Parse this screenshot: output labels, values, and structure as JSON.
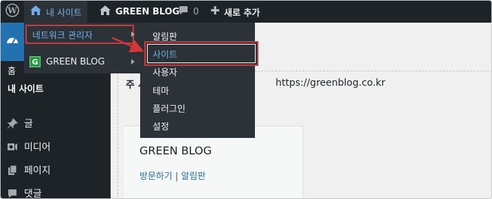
{
  "admin_bar": {
    "site_name": "내 사이트",
    "blog_name": "GREEN BLOG",
    "comments_count": "0",
    "new_label": "새로 추가"
  },
  "sidebar": {
    "home_label": "홈",
    "my_sites_label": "내 사이트",
    "items": [
      {
        "label": "글",
        "icon": "pushpin-icon"
      },
      {
        "label": "미디어",
        "icon": "media-icon"
      },
      {
        "label": "페이지",
        "icon": "page-icon"
      },
      {
        "label": "댓글",
        "icon": "comment-icon"
      }
    ]
  },
  "flyout_main": {
    "network_admin": "네트워크 관리자",
    "green_blog": "GREEN BLOG",
    "green_logo_letter": "G"
  },
  "flyout_network": {
    "items": [
      "알림판",
      "사이트",
      "사용자",
      "테마",
      "플러그인",
      "설정"
    ]
  },
  "main": {
    "primary_site_label": "주 사",
    "primary_site_url": "https://greenblog.co.kr",
    "card_title": "GREEN BLOG",
    "card_visit": "방문하기",
    "card_separator": " | ",
    "card_dashboard": "알림판"
  },
  "colors": {
    "admin_bar_bg": "#1d2327",
    "flyout_bg": "#2c3338",
    "link_blue": "#72aee6",
    "highlight_red": "#d63638",
    "active_blue": "#2271b1"
  }
}
